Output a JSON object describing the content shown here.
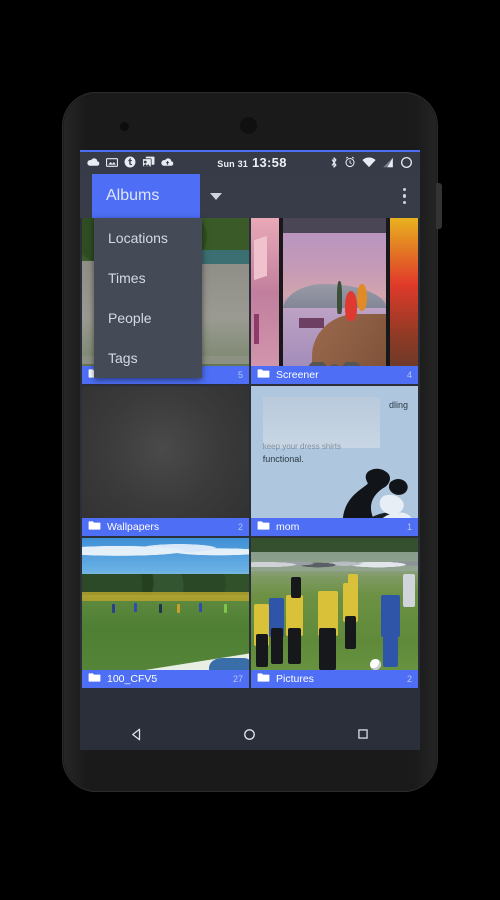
{
  "statusbar": {
    "date": "Sun 31",
    "time": "13:58",
    "left_icons": [
      "cloud-icon",
      "image-icon",
      "tumblr-icon",
      "photos-stack-icon",
      "cloud-upload-icon"
    ],
    "right_icons": [
      "bluetooth-icon",
      "alarm-icon",
      "wifi-icon",
      "signal-icon",
      "battery-icon"
    ]
  },
  "actionbar": {
    "spinner_label": "Albums",
    "caret_icon": "dropdown-caret-icon",
    "overflow_icon": "overflow-menu-icon"
  },
  "dropdown": {
    "items": [
      {
        "label": "Locations"
      },
      {
        "label": "Times"
      },
      {
        "label": "People"
      },
      {
        "label": "Tags"
      }
    ]
  },
  "albums": [
    {
      "name": "",
      "count": "5",
      "icon": "folder-icon",
      "art": "drive"
    },
    {
      "name": "Screener",
      "count": "4",
      "icon": "folder-icon",
      "art": "shot"
    },
    {
      "name": "Wallpapers",
      "count": "2",
      "icon": "folder-icon",
      "art": "dark"
    },
    {
      "name": "mom",
      "count": "1",
      "icon": "folder-icon",
      "art": "flyer"
    },
    {
      "name": "100_CFV5",
      "count": "27",
      "icon": "folder-icon",
      "art": "field"
    },
    {
      "name": "Pictures",
      "count": "2",
      "icon": "folder-icon",
      "art": "game"
    }
  ],
  "thumbnail_text": {
    "flyer_line1": "dling",
    "flyer_line2": "keep your dress shirts",
    "flyer_line3": "functional."
  },
  "navbar": {
    "back": "back-icon",
    "home": "home-icon",
    "recents": "recents-icon"
  },
  "colors": {
    "accent": "#4d6ef5",
    "statusbar_bg": "#373b47",
    "actionbar_bg": "#383c48",
    "screen_bg": "#2b2f3a",
    "dropdown_bg": "#454a57"
  }
}
